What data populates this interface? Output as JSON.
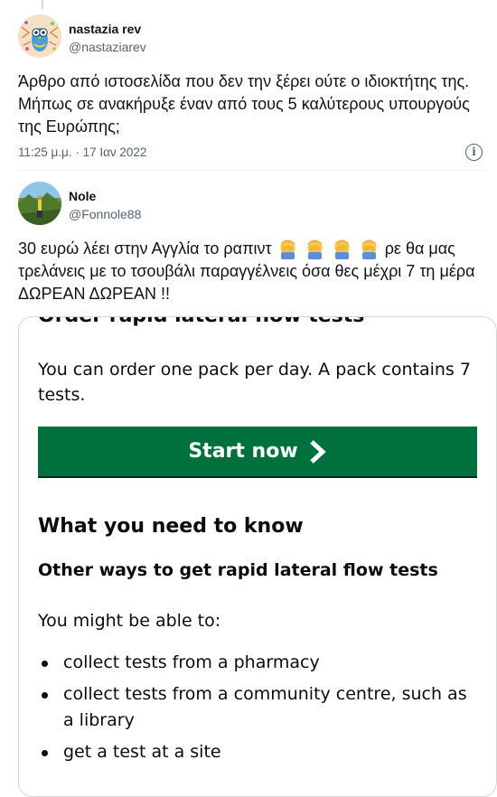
{
  "tweets": [
    {
      "author_name": "nastazia rev",
      "handle": "@nastaziarev",
      "text": "Άρθρο από ιστοσελίδα που δεν την ξέρει ούτε ο ιδιοκτήτης της. Μήπως σε ανακήρυξε έναν από τους 5 καλύτερους υπουργούς της Ευρώπης;",
      "timestamp": "11:25 μ.μ. · 17 Ιαν 2022",
      "info_icon": "info-icon"
    },
    {
      "author_name": "Nole",
      "handle": "@Fonnole88",
      "text_before_emoji": "30 ευρώ λέει στην Αγγλία το ραπιντ",
      "emoji": "facepalm-emoji",
      "emoji_count": 4,
      "text_after_emoji": "ρε θα μας τρελάνεις με το τσουβάλι παραγγέλνεις όσα θες μέχρι 7 τη μέρα ΔΩΡΕΑΝ ΔΩΡΕΑΝ !!"
    }
  ],
  "embedded_page": {
    "heading_cut": "Order rapid lateral flow tests",
    "intro": "You can order one pack per day. A pack contains 7 tests.",
    "start_button": "Start now",
    "start_icon": "chevron-right-icon",
    "h2": "What you need to know",
    "h3": "Other ways to get rapid lateral flow tests",
    "lead": "You might be able to:",
    "bullets": [
      "collect tests from a pharmacy",
      "collect tests from a community centre, such as a library",
      "get a test at a site"
    ],
    "colors": {
      "button": "#00703c",
      "text": "#0b0c0c"
    }
  }
}
